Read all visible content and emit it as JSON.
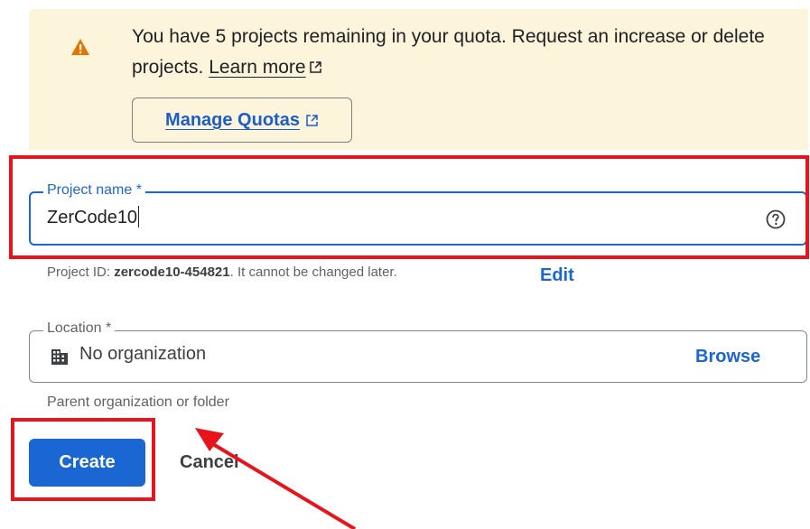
{
  "quota": {
    "message": "You have 5 projects remaining in your quota. Request an increase or delete projects.",
    "learn_more": "Learn more",
    "manage_button": "Manage Quotas"
  },
  "project_name": {
    "label": "Project name *",
    "value": "ZerCode10"
  },
  "project_id": {
    "prefix": "Project ID: ",
    "id": "zercode10-454821",
    "suffix": ". It cannot be changed later.",
    "edit_label": "Edit"
  },
  "location": {
    "label": "Location *",
    "value": "No organization",
    "browse_label": "Browse",
    "hint": "Parent organization or folder"
  },
  "actions": {
    "create_label": "Create",
    "cancel_label": "Cancel"
  },
  "colors": {
    "banner": "#fdf4dc",
    "accent": "#1a66d2",
    "warning": "#e37400",
    "annotation": "#e8141c"
  }
}
